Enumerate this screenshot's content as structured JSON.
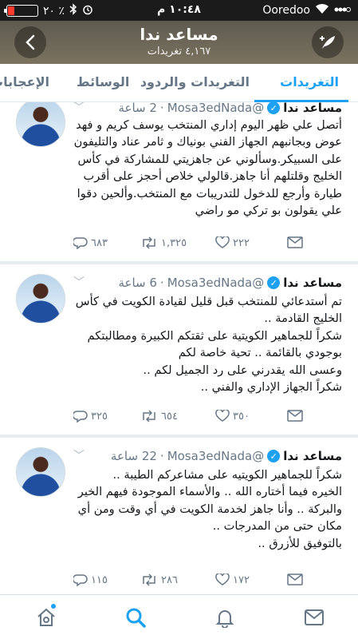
{
  "status_bar": {
    "battery_text": "٢٠ ٪",
    "battery_level": 0.2,
    "time": "١٠:٤٨ م",
    "carrier": "Ooredoo"
  },
  "header": {
    "title": "مساعد ندا",
    "subtitle": "٤,١٦٧ تغريدات"
  },
  "tabs": [
    {
      "label": "التغريدات",
      "active": true
    },
    {
      "label": "التغريدات والردود",
      "active": false
    },
    {
      "label": "الوسائط",
      "active": false
    },
    {
      "label": "الإعجابات",
      "active": false
    }
  ],
  "tweets": [
    {
      "name": "مساعد ندا",
      "handle": "@Mosa3edNada",
      "time": "2 ساعة",
      "text": "أتصل علي ظهر اليوم إداري المنتخب يوسف كريم و فهد عوض وبجانبهم الجهاز الفني بونياك و ثامر عناد والتليفون على السبيكر.وسألوني عن جاهزيتي للمشاركة في كأس الخليج وقلتلهم أنا جاهز.قالولي خلاص أحجز على أقرب طيارة وأرجع للدخول للتدريبات مع المنتخب.وألحين دقوا علي يقولون بو تركي مو راضي",
      "replies": "٦٨٣",
      "retweets": "١,٣٢٥",
      "likes": "٢٢٢"
    },
    {
      "name": "مساعد ندا",
      "handle": "@Mosa3edNada",
      "time": "6 ساعة",
      "text": "تم أستدعائي للمنتخب قبل قليل لقيادة الكويت في كأس الخليج القادمة ..\nشكراً للجماهير الكويتية على ثقتكم الكبيرة ومطالبتكم بوجودي بالقائمة .. تحية خاصة لكم\nوعسى الله يقدرني على رد الجميل لكم ..\nشكراً الجهاز الإداري والفني ..",
      "replies": "٣٢٥",
      "retweets": "٦٥٤",
      "likes": "٣٥٠"
    },
    {
      "name": "مساعد ندا",
      "handle": "@Mosa3edNada",
      "time": "22 ساعة",
      "text": "شكراً للجماهير الكويتيه على مشاعركم الطيبة ..\nالخيره فيما أختاره الله .. والأسماء الموجودة فيهم الخير والبركة .. وأنا جاهز لخدمة الكويت في أي وقت ومن أي مكان حتى من المدرجات ..\nبالتوفيق للأزرق ..",
      "replies": "١١٥",
      "retweets": "٢٨٦",
      "likes": "١٧٢"
    }
  ],
  "icons": {
    "wifi": "wifi-icon",
    "bluetooth": "bluetooth-icon",
    "alarm": "alarm-icon",
    "reply": "reply-icon",
    "retweet": "retweet-icon",
    "like": "heart-icon",
    "dm": "envelope-icon"
  },
  "colors": {
    "accent": "#1da1f2",
    "battery_low": "#ff3b30"
  }
}
